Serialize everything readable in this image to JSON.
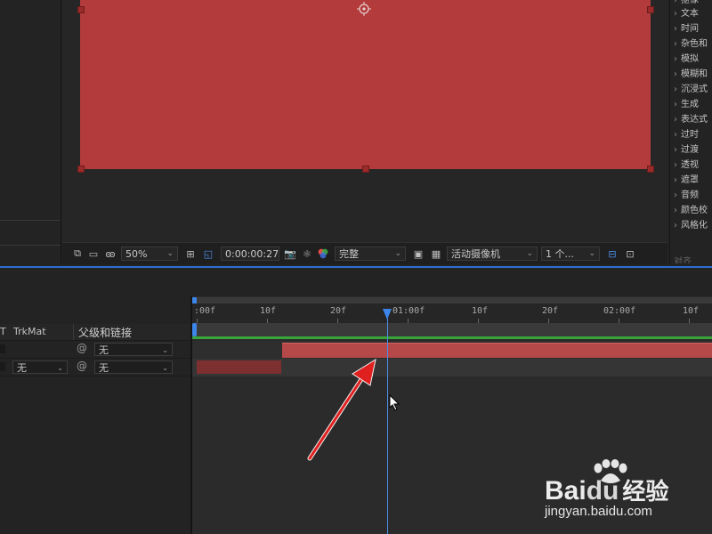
{
  "viewer": {
    "zoom": "50%",
    "timecode": "0:00:00:27",
    "resolution": "完整",
    "camera": "活动摄像机",
    "views": "1 个...",
    "layer_color": "#b33b3b"
  },
  "effects": {
    "items": [
      "抠像",
      "文本",
      "时间",
      "杂色和",
      "模拟",
      "模糊和",
      "沉浸式",
      "生成",
      "表达式",
      "过时",
      "过渡",
      "透视",
      "遮罩",
      "音频",
      "颜色校",
      "风格化"
    ],
    "footer": "对齐"
  },
  "timeline": {
    "columns": {
      "trkmat": "TrkMat",
      "parent": "父级和链接",
      "t_mark": "T"
    },
    "ruler_labels": [
      ":00f",
      "10f",
      "20f",
      "01:00f",
      "10f",
      "20f",
      "02:00f",
      "10f"
    ],
    "rows": [
      {
        "trkmat": "",
        "parent": "无"
      },
      {
        "trkmat": "无",
        "parent": "无"
      }
    ],
    "playhead_color": "#3c86ea",
    "bar_color": "#b54848"
  },
  "watermark": {
    "brand": "Bai",
    "brand2": "du",
    "product": "经验",
    "url": "jingyan.baidu.com"
  }
}
